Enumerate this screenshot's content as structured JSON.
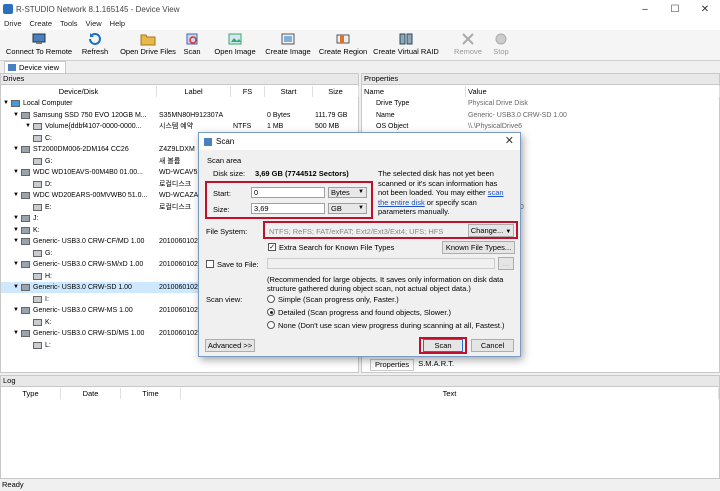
{
  "window": {
    "title": "R-STUDIO Network 8.1.165145 - Device View",
    "min": "–",
    "max": "☐",
    "close": "✕"
  },
  "menu": [
    "Drive",
    "Create",
    "Tools",
    "View",
    "Help"
  ],
  "toolbar": [
    {
      "label": "Connect To Remote",
      "icon": "connect-icon"
    },
    {
      "label": "Refresh",
      "icon": "refresh-icon"
    },
    {
      "label": "Open Drive Files",
      "icon": "folder-icon"
    },
    {
      "label": "Scan",
      "icon": "scan-icon"
    },
    {
      "label": "Open Image",
      "icon": "open-image-icon"
    },
    {
      "label": "Create Image",
      "icon": "create-image-icon"
    },
    {
      "label": "Create Region",
      "icon": "region-icon"
    },
    {
      "label": "Create Virtual RAID",
      "icon": "raid-icon"
    },
    {
      "label": "Remove",
      "icon": "remove-icon"
    },
    {
      "label": "Stop",
      "icon": "stop-icon"
    }
  ],
  "tab": "Device view",
  "drives": {
    "header": "Drives",
    "columns": [
      "Device/Disk",
      "Label",
      "FS",
      "Start",
      "Size"
    ],
    "rows": [
      {
        "indent": 1,
        "name": "Local Computer",
        "label": "",
        "fs": "",
        "start": "",
        "size": ""
      },
      {
        "indent": 2,
        "name": "Samsung SSD 750 EVO 120GB M...",
        "label": "S35MN80H912307A",
        "fs": "",
        "start": "0 Bytes",
        "size": "111.79 GB"
      },
      {
        "indent": 3,
        "name": "Volume{ddbf4107-0000-0000...",
        "label": "시스템 예약",
        "fs": "NTFS",
        "start": "1 MB",
        "size": "500 MB"
      },
      {
        "indent": 3,
        "name": "C:",
        "label": "",
        "fs": "",
        "start": "",
        "size": ""
      },
      {
        "indent": 2,
        "name": "ST2000DM006-2DM164 CC26",
        "label": "Z4Z9LDXM",
        "fs": "",
        "start": "",
        "size": ""
      },
      {
        "indent": 3,
        "name": "G:",
        "label": "새 볼륨",
        "fs": "",
        "start": "",
        "size": ""
      },
      {
        "indent": 2,
        "name": "WDC WD10EAVS-00M4B0 01.00...",
        "label": "WD-WCAV5",
        "fs": "",
        "start": "",
        "size": ""
      },
      {
        "indent": 3,
        "name": "D:",
        "label": "로컬디스크",
        "fs": "",
        "start": "",
        "size": ""
      },
      {
        "indent": 2,
        "name": "WDC WD20EARS-00MVWB0 51.0...",
        "label": "WD-WCAZA",
        "fs": "",
        "start": "",
        "size": ""
      },
      {
        "indent": 3,
        "name": "E:",
        "label": "로컬디스크",
        "fs": "",
        "start": "",
        "size": ""
      },
      {
        "indent": 2,
        "name": "J:",
        "label": "",
        "fs": "",
        "start": "",
        "size": ""
      },
      {
        "indent": 2,
        "name": "K:",
        "label": "",
        "fs": "",
        "start": "",
        "size": ""
      },
      {
        "indent": 2,
        "name": "Generic- USB3.0 CRW-CF/MD 1.00",
        "label": "2010060102",
        "fs": "",
        "start": "",
        "size": ""
      },
      {
        "indent": 3,
        "name": "G:",
        "label": "",
        "fs": "",
        "start": "",
        "size": ""
      },
      {
        "indent": 2,
        "name": "Generic- USB3.0 CRW-SM/xD 1.00",
        "label": "2010060102",
        "fs": "",
        "start": "",
        "size": ""
      },
      {
        "indent": 3,
        "name": "H:",
        "label": "",
        "fs": "",
        "start": "",
        "size": ""
      },
      {
        "indent": 2,
        "name": "Generic- USB3.0 CRW-SD 1.00",
        "label": "2010060102",
        "fs": "",
        "start": "",
        "size": "",
        "selected": true
      },
      {
        "indent": 3,
        "name": "I:",
        "label": "",
        "fs": "",
        "start": "",
        "size": ""
      },
      {
        "indent": 2,
        "name": "Generic- USB3.0 CRW-MS 1.00",
        "label": "2010060102",
        "fs": "",
        "start": "",
        "size": ""
      },
      {
        "indent": 3,
        "name": "K:",
        "label": "",
        "fs": "",
        "start": "",
        "size": ""
      },
      {
        "indent": 2,
        "name": "Generic- USB3.0 CRW-SD/MS 1.00",
        "label": "2010060102",
        "fs": "",
        "start": "",
        "size": ""
      },
      {
        "indent": 3,
        "name": "L:",
        "label": "",
        "fs": "",
        "start": "",
        "size": ""
      }
    ]
  },
  "properties": {
    "header": "Properties",
    "columns": [
      "Name",
      "Value"
    ],
    "rows": [
      {
        "name": "Drive Type",
        "value": "Physical Drive Disk"
      },
      {
        "name": "Name",
        "value": "Generic- USB3.0 CRW-SD 1.00"
      },
      {
        "name": "OS Object",
        "value": "\\\\.\\PhysicalDrive6"
      },
      {
        "name": "",
        "value": "Physical"
      },
      {
        "name": "",
        "value": "2 Sectors)"
      },
      {
        "name": "",
        "value": ""
      },
      {
        "name": "",
        "value": "2 Sectors)"
      },
      {
        "name": "",
        "value": ""
      },
      {
        "name": "",
        "value": ""
      },
      {
        "name": "",
        "value": "3.0 CRW-SD 1.00"
      }
    ],
    "tabs": [
      "Properties",
      "S.M.A.R.T."
    ]
  },
  "log": {
    "header": "Log",
    "columns": [
      "Type",
      "Date",
      "Time",
      "Text"
    ]
  },
  "status": "Ready",
  "dialog": {
    "title": "Scan",
    "scan_area": "Scan area",
    "disk_size_label": "Disk size:",
    "disk_size_value": "3,69 GB (7744512 Sectors)",
    "start_label": "Start:",
    "start_value": "0",
    "start_unit": "Bytes",
    "size_label": "Size:",
    "size_value": "3,69",
    "size_unit": "GB",
    "info_1": "The selected disk has not yet been",
    "info_2": "scanned or it's scan information has",
    "info_3": "not been loaded. You may either",
    "info_link1": "scan",
    "info_link2": "the entire disk",
    "info_4": " or specify scan",
    "info_5": "parameters manually.",
    "fs_label": "File System:",
    "fs_value": "NTFS; ReFS; FAT/exFAT; Ext2/Ext3/Ext4; UFS; HFS",
    "change_btn": "Change...",
    "extra_search": "Extra Search for Known File Types",
    "known_btn": "Known File Types...",
    "save_to_file": "Save to File:",
    "browse_btn": "...",
    "rec_1": "(Recommended for large objects. It saves only information on disk data",
    "rec_2": "structure gathered during object scan, not actual object data.)",
    "scan_view": "Scan view:",
    "opt_simple": "Simple (Scan progress only, Faster.)",
    "opt_detailed": "Detailed (Scan progress and found objects, Slower.)",
    "opt_none": "None (Don't use scan view progress during scanning at all, Fastest.)",
    "advanced_btn": "Advanced >>",
    "scan_btn": "Scan",
    "cancel_btn": "Cancel"
  }
}
